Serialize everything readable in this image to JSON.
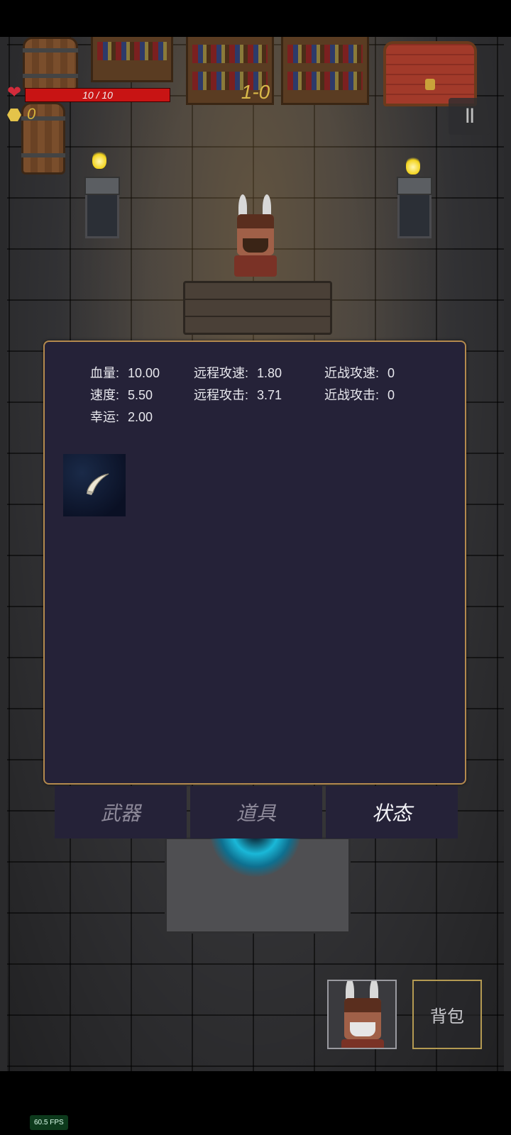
{
  "hud": {
    "health_text": "10 / 10",
    "health_fraction": 1.0,
    "coins": "0",
    "level": "1-0",
    "pause_label": "II"
  },
  "stats": [
    {
      "label": "血量:",
      "value": "10.00"
    },
    {
      "label": "速度:",
      "value": "5.50"
    },
    {
      "label": "幸运:",
      "value": "2.00"
    },
    {
      "label": "远程攻速:",
      "value": "1.80"
    },
    {
      "label": "远程攻击:",
      "value": "3.71"
    },
    {
      "label": "近战攻速:",
      "value": "0"
    },
    {
      "label": "近战攻击:",
      "value": "0"
    }
  ],
  "items": [
    {
      "icon": "horn-icon"
    }
  ],
  "tabs": [
    {
      "label": "武器",
      "active": false
    },
    {
      "label": "道具",
      "active": false
    },
    {
      "label": "状态",
      "active": true
    }
  ],
  "bottom": {
    "bag_label": "背包"
  },
  "fps": "60.5 FPS",
  "colors": {
    "panel_bg": "#252238",
    "panel_border": "#b48a4e",
    "health": "#c81414",
    "level_text": "#d9b94a"
  }
}
